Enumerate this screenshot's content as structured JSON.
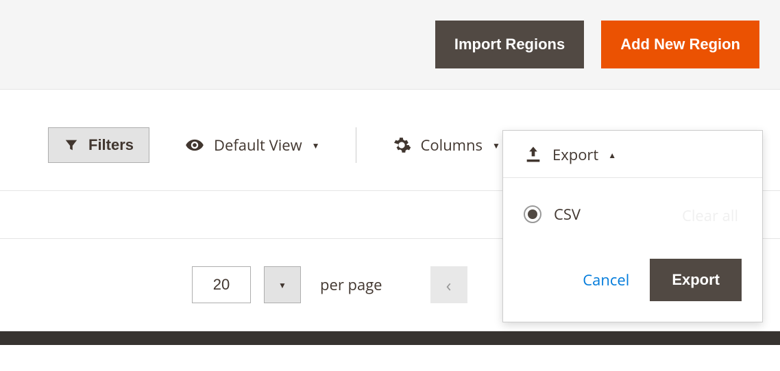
{
  "header": {
    "import_label": "Import Regions",
    "add_label": "Add New Region"
  },
  "toolbar": {
    "filters_label": "Filters",
    "view_label": "Default View",
    "columns_label": "Columns",
    "export_label": "Export"
  },
  "export_panel": {
    "options": [
      {
        "label": "CSV",
        "selected": true
      }
    ],
    "clear_all_label": "Clear all",
    "cancel_label": "Cancel",
    "export_button_label": "Export"
  },
  "pager": {
    "page_size": "20",
    "per_page_label": "per page"
  }
}
